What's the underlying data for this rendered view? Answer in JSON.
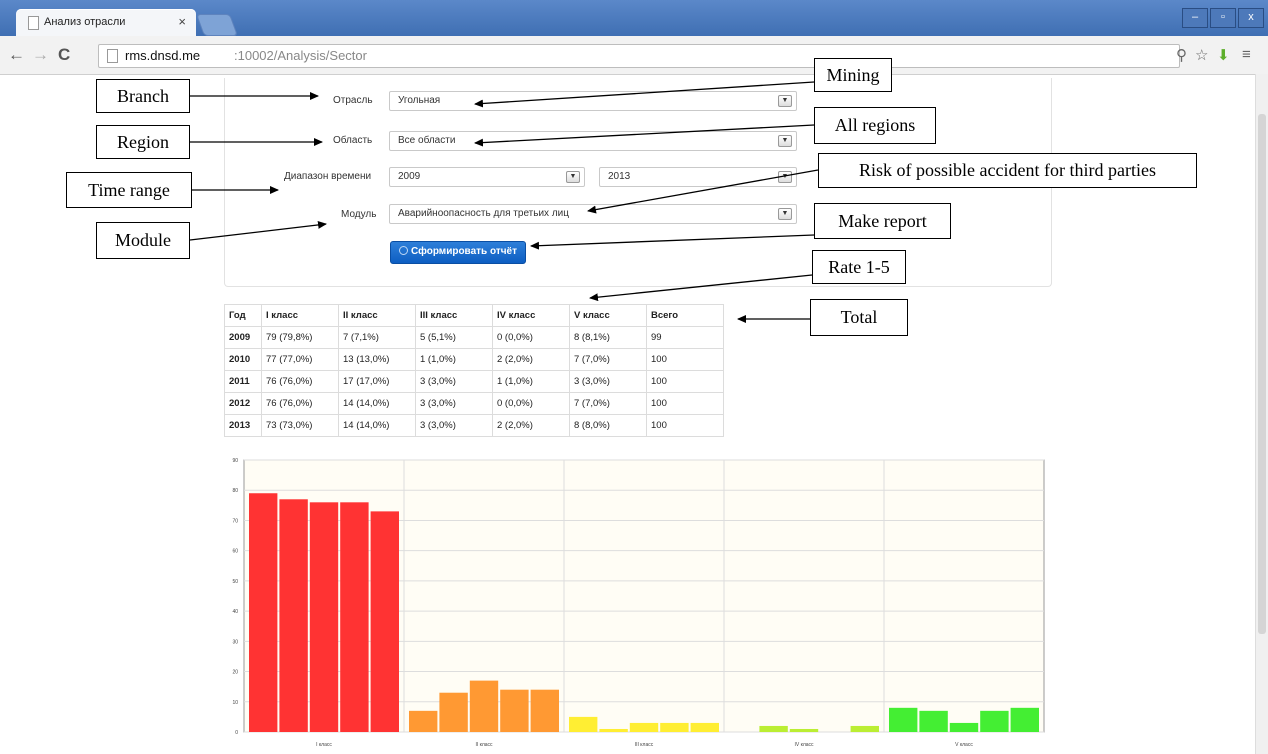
{
  "browser": {
    "tab_title": "Анализ отрасли",
    "tab_close": "×",
    "url_host": "rms.dnsd.me",
    "url_path": ":10002/Analysis/Sector",
    "window_buttons": [
      "–",
      "▫",
      "x"
    ]
  },
  "form": {
    "branch_label": "Отрасль",
    "branch_value": "Угольная",
    "region_label": "Область",
    "region_value": "Все области",
    "time_label": "Диапазон времени",
    "time_from": "2009",
    "time_to": "2013",
    "module_label": "Модуль",
    "module_value": "Аварийноопасность для третьих лиц",
    "submit_label": "Сформировать отчёт"
  },
  "table": {
    "headers": [
      "Год",
      "I класс",
      "II класс",
      "III класс",
      "IV класс",
      "V класс",
      "Всего"
    ],
    "rows": [
      [
        "2009",
        "79 (79,8%)",
        "7 (7,1%)",
        "5 (5,1%)",
        "0 (0,0%)",
        "8 (8,1%)",
        "99"
      ],
      [
        "2010",
        "77 (77,0%)",
        "13 (13,0%)",
        "1 (1,0%)",
        "2 (2,0%)",
        "7 (7,0%)",
        "100"
      ],
      [
        "2011",
        "76 (76,0%)",
        "17 (17,0%)",
        "3 (3,0%)",
        "1 (1,0%)",
        "3 (3,0%)",
        "100"
      ],
      [
        "2012",
        "76 (76,0%)",
        "14 (14,0%)",
        "3 (3,0%)",
        "0 (0,0%)",
        "7 (7,0%)",
        "100"
      ],
      [
        "2013",
        "73 (73,0%)",
        "14 (14,0%)",
        "3 (3,0%)",
        "2 (2,0%)",
        "8 (8,0%)",
        "100"
      ]
    ]
  },
  "annotations": {
    "branch": "Branch",
    "region": "Region",
    "time_range": "Time range",
    "module": "Module",
    "mining": "Mining",
    "all_regions": "All regions",
    "risk": "Risk of possible accident for third parties",
    "make_report": "Make report",
    "rate": "Rate 1-5",
    "total": "Total"
  },
  "chart_data": {
    "type": "bar",
    "categories": [
      "I класс",
      "II класс",
      "III класс",
      "IV класс",
      "V класс"
    ],
    "series": [
      {
        "values": [
          79,
          7,
          5,
          0,
          8
        ]
      },
      {
        "values": [
          77,
          13,
          1,
          2,
          7
        ]
      },
      {
        "values": [
          76,
          17,
          3,
          1,
          3
        ]
      },
      {
        "values": [
          76,
          14,
          3,
          0,
          7
        ]
      },
      {
        "values": [
          73,
          14,
          3,
          2,
          8
        ]
      }
    ],
    "category_colors": [
      "#ff3333",
      "#ff9933",
      "#ffee33",
      "#bbee33",
      "#44ee33"
    ],
    "ylim": [
      0,
      90
    ],
    "yticks": [
      0,
      10,
      20,
      30,
      40,
      50,
      60,
      70,
      80,
      90
    ],
    "grid": true,
    "background": "#fffdf5"
  }
}
